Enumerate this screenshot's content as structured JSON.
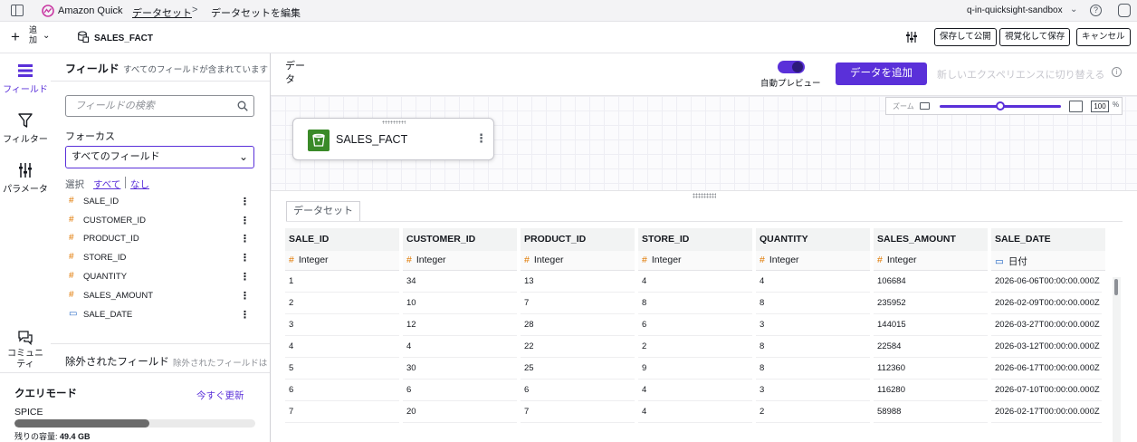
{
  "topbar": {
    "app_name": "Amazon Quick",
    "breadcrumb": [
      "データセット",
      "データセットを編集"
    ],
    "account": "q-in-quicksight-sandbox"
  },
  "toolbar": {
    "add_label": "追加",
    "dataset_name": "SALES_FACT",
    "save_publish": "保存して公開",
    "save_visualize": "視覚化して保存",
    "cancel": "キャンセル"
  },
  "rail": {
    "fields": "フィールド",
    "filter": "フィルター",
    "parameters": "パラメータ",
    "community": "コミュニティ"
  },
  "fields_panel": {
    "title": "フィールド",
    "subtitle": "すべてのフィールドが含まれています",
    "search_placeholder": "フィールドの検索",
    "focus_label": "フォーカス",
    "focus_value": "すべてのフィールド",
    "select_label": "選択",
    "select_all": "すべて",
    "select_none": "なし",
    "fields": [
      {
        "name": "SALE_ID",
        "type": "number"
      },
      {
        "name": "CUSTOMER_ID",
        "type": "number"
      },
      {
        "name": "PRODUCT_ID",
        "type": "number"
      },
      {
        "name": "STORE_ID",
        "type": "number"
      },
      {
        "name": "QUANTITY",
        "type": "number"
      },
      {
        "name": "SALES_AMOUNT",
        "type": "number"
      },
      {
        "name": "SALE_DATE",
        "type": "date"
      }
    ],
    "excluded_title": "除外されたフィールド",
    "excluded_subtitle": "除外されたフィールドはありません"
  },
  "query_mode": {
    "title": "クエリモード",
    "refresh": "今すぐ更新",
    "spice_label": "SPICE",
    "spice_used_fraction": 0.56,
    "capacity_label": "残りの容量:",
    "capacity_value": "49.4 GB"
  },
  "main": {
    "data_title": "データ",
    "auto_preview": "自動プレビュー",
    "auto_preview_on": true,
    "add_data": "データを追加",
    "switch_experience": "新しいエクスペリエンスに切り替える",
    "zoom_label": "ズーム",
    "zoom_value": "100",
    "zoom_unit": "%",
    "zoom_slider_fraction": 0.5,
    "node_name": "SALES_FACT",
    "tab_label": "データセット"
  },
  "grid": {
    "columns": [
      {
        "name": "SALE_ID",
        "type": "Integer",
        "icon": "number"
      },
      {
        "name": "CUSTOMER_ID",
        "type": "Integer",
        "icon": "number"
      },
      {
        "name": "PRODUCT_ID",
        "type": "Integer",
        "icon": "number"
      },
      {
        "name": "STORE_ID",
        "type": "Integer",
        "icon": "number"
      },
      {
        "name": "QUANTITY",
        "type": "Integer",
        "icon": "number"
      },
      {
        "name": "SALES_AMOUNT",
        "type": "Integer",
        "icon": "number"
      },
      {
        "name": "SALE_DATE",
        "type": "日付",
        "icon": "date"
      }
    ],
    "rows": [
      [
        "1",
        "34",
        "13",
        "4",
        "4",
        "106684",
        "2026-06-06T00:00:00.000Z"
      ],
      [
        "2",
        "10",
        "7",
        "8",
        "8",
        "235952",
        "2026-02-09T00:00:00.000Z"
      ],
      [
        "3",
        "12",
        "28",
        "6",
        "3",
        "144015",
        "2026-03-27T00:00:00.000Z"
      ],
      [
        "4",
        "4",
        "22",
        "2",
        "8",
        "22584",
        "2026-03-12T00:00:00.000Z"
      ],
      [
        "5",
        "30",
        "25",
        "9",
        "8",
        "112360",
        "2026-06-17T00:00:00.000Z"
      ],
      [
        "6",
        "6",
        "6",
        "4",
        "3",
        "116280",
        "2026-07-10T00:00:00.000Z"
      ],
      [
        "7",
        "20",
        "7",
        "4",
        "2",
        "58988",
        "2026-02-17T00:00:00.000Z"
      ]
    ]
  },
  "colors": {
    "accent": "#5a30d9",
    "number_icon": "#e07800",
    "date_icon": "#2266c4",
    "node_icon": "#3a8a28"
  }
}
